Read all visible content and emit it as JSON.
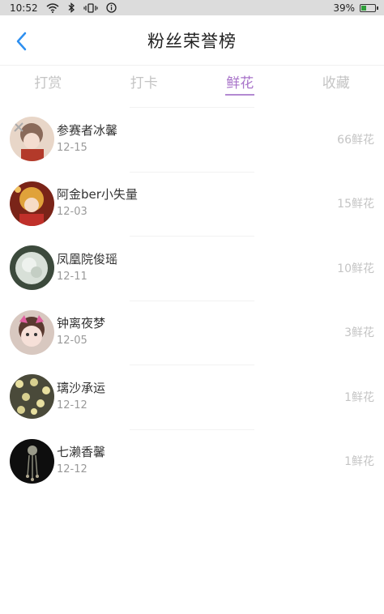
{
  "status_bar": {
    "time": "10:52",
    "battery": "39%",
    "battery_level": 0.39,
    "icons": [
      "wifi-icon",
      "bluetooth-icon",
      "vibrate-icon",
      "info-icon"
    ]
  },
  "header": {
    "title": "粉丝荣誉榜",
    "back_icon": "back-arrow-icon",
    "accent_color": "#2d8ff0"
  },
  "tabs": [
    {
      "label": "打赏",
      "active": false
    },
    {
      "label": "打卡",
      "active": false
    },
    {
      "label": "鲜花",
      "active": true
    },
    {
      "label": "收藏",
      "active": false
    }
  ],
  "ranking": [
    {
      "name": "参赛者冰馨",
      "date": "12-15",
      "count": "66鲜花"
    },
    {
      "name": "阿金ber小失量",
      "date": "12-03",
      "count": "15鲜花"
    },
    {
      "name": "凤凰院俊瑶",
      "date": "12-11",
      "count": "10鲜花"
    },
    {
      "name": "钟离夜梦",
      "date": "12-05",
      "count": "3鲜花"
    },
    {
      "name": "璃沙承运",
      "date": "12-12",
      "count": "1鲜花"
    },
    {
      "name": "七濑香馨",
      "date": "12-12",
      "count": "1鲜花"
    }
  ]
}
